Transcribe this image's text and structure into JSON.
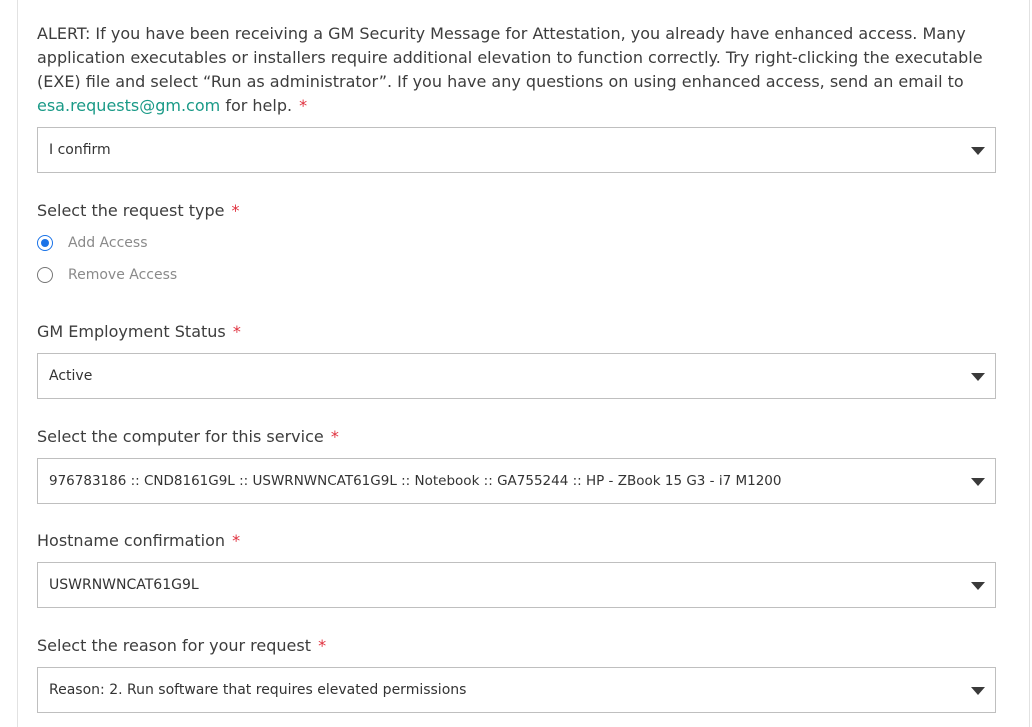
{
  "alert": {
    "text": "ALERT: If you have been receiving a GM Security Message for Attestation, you already have enhanced access. Many application executables or installers require additional elevation to function correctly. Try right-clicking the executable (EXE) file and select “Run as administrator”. If you have any questions on using enhanced access, send an email to ",
    "email": "esa.requests@gm.com",
    "suffix": " for help.",
    "required_mark": "*",
    "confirm_value": "I confirm"
  },
  "request_type": {
    "label": "Select the request type",
    "required_mark": "*",
    "options": [
      {
        "label": "Add Access",
        "checked": true
      },
      {
        "label": "Remove Access",
        "checked": false
      }
    ]
  },
  "employment_status": {
    "label": "GM Employment Status",
    "required_mark": "*",
    "value": "Active"
  },
  "computer": {
    "label": "Select the computer for this service",
    "required_mark": "*",
    "value": "976783186 :: CND8161G9L :: USWRNWNCAT61G9L :: Notebook :: GA755244 :: HP - ZBook 15 G3 - i7 M1200"
  },
  "hostname": {
    "label": "Hostname confirmation",
    "required_mark": "*",
    "value": "USWRNWNCAT61G9L"
  },
  "reason": {
    "label": "Select the reason for your request",
    "required_mark": "*",
    "value": "Reason: 2. Run software that requires elevated permissions"
  },
  "colors": {
    "link": "#1a9a87",
    "required": "#e0303d",
    "radio_selected": "#1a73e8"
  }
}
